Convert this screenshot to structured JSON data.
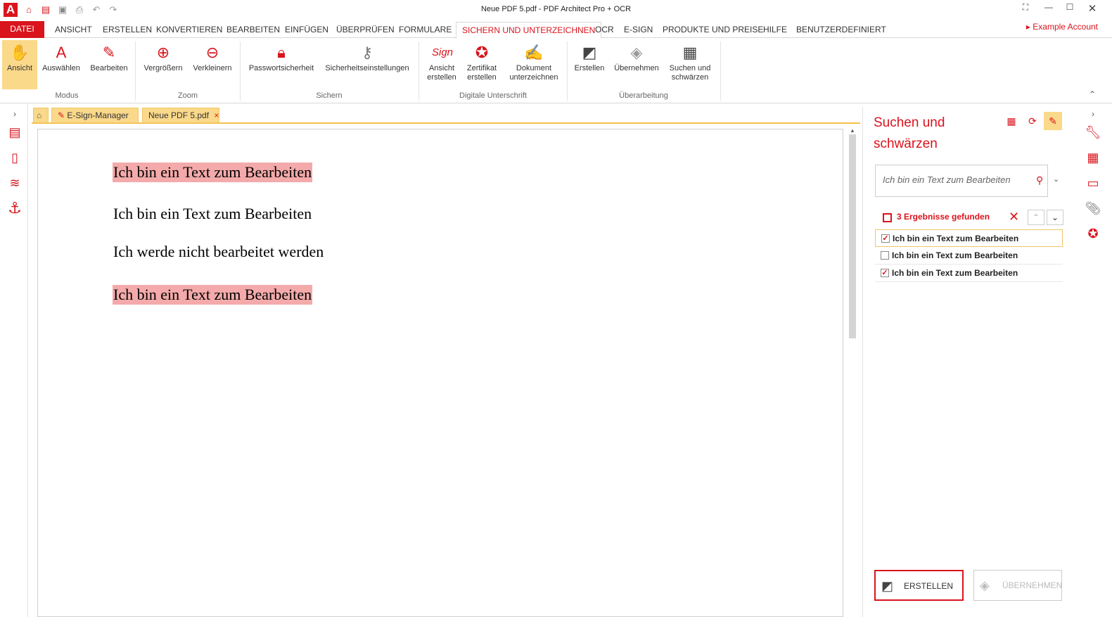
{
  "window": {
    "title": "Neue PDF 5.pdf   -   PDF Architect Pro + OCR",
    "logo": "A"
  },
  "quick_access": [
    "home-icon",
    "open-folder-icon",
    "save-icon",
    "print-icon",
    "undo-icon",
    "redo-icon"
  ],
  "menu_tabs": [
    "DATEI",
    "ANSICHT",
    "ERSTELLEN",
    "KONVERTIEREN",
    "BEARBEITEN",
    "EINFÜGEN",
    "ÜBERPRÜFEN",
    "FORMULARE",
    "SICHERN UND UNTERZEICHNEN",
    "OCR",
    "E-SIGN",
    "PRODUKTE UND PREISE",
    "HILFE",
    "BENUTZERDEFINIERT"
  ],
  "account": "Example Account",
  "ribbon": {
    "modus": {
      "label": "Modus",
      "buttons": [
        "Ansicht",
        "Auswählen",
        "Bearbeiten"
      ]
    },
    "zoom": {
      "label": "Zoom",
      "buttons": [
        "Vergrößern",
        "Verkleinern"
      ]
    },
    "sichern": {
      "label": "Sichern",
      "buttons": [
        "Passwortsicherheit",
        "Sicherheitseinstellungen"
      ]
    },
    "digital": {
      "label": "Digitale Unterschrift",
      "buttons": [
        "Ansicht erstellen",
        "Zertifikat erstellen",
        "Dokument unterzeichnen"
      ]
    },
    "ueberarbeitung": {
      "label": "Überarbeitung",
      "buttons": [
        "Erstellen",
        "Übernehmen",
        "Suchen und schwärzen"
      ]
    }
  },
  "doc_tabs": {
    "esign": "E-Sign-Manager",
    "file": "Neue PDF 5.pdf",
    "close": "×"
  },
  "document": {
    "lines": [
      "Ich bin ein Text zum Bearbeiten",
      "Ich bin ein Text zum Bearbeiten",
      "Ich werde nicht bearbeitet werden",
      "Ich bin ein Text zum Bearbeiten"
    ],
    "highlight_color": "#f4aaaa"
  },
  "panel": {
    "title_line1": "Suchen und",
    "title_line2": "schwärzen",
    "search_value": "Ich bin ein Text zum Bearbeiten",
    "results_label": "3 Ergebnisse gefunden",
    "results": [
      {
        "text": "Ich bin ein Text zum Bearbeiten",
        "checked": true
      },
      {
        "text": "Ich bin ein Text zum Bearbeiten",
        "checked": false
      },
      {
        "text": "Ich bin ein Text zum Bearbeiten",
        "checked": true
      }
    ],
    "create_button": "ERSTELLEN",
    "apply_button": "ÜBERNEHMEN"
  },
  "colors": {
    "accent": "#d9141c",
    "highlight": "#fbd98a"
  }
}
